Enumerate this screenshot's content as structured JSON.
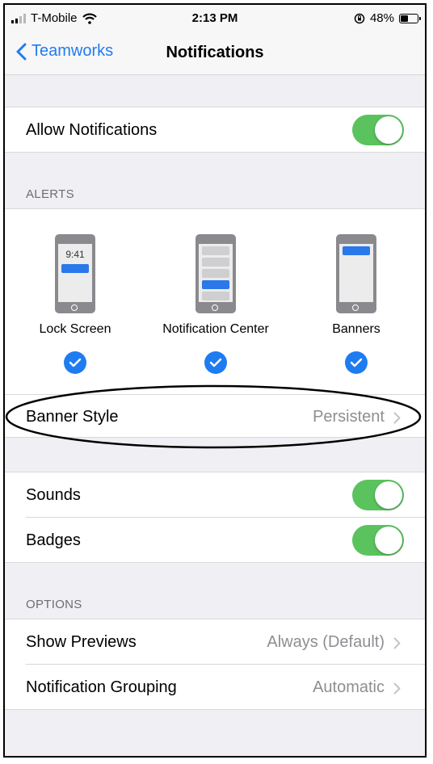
{
  "status_bar": {
    "carrier": "T-Mobile",
    "time": "2:13 PM",
    "battery": "48%",
    "battery_level": 0.48
  },
  "nav": {
    "back_label": "Teamworks",
    "title": "Notifications"
  },
  "allow_notifications": {
    "label": "Allow Notifications",
    "on": true
  },
  "alerts": {
    "header": "ALERTS",
    "lock_screen_time": "9:41",
    "options": [
      {
        "label": "Lock Screen",
        "checked": true
      },
      {
        "label": "Notification Center",
        "checked": true
      },
      {
        "label": "Banners",
        "checked": true
      }
    ],
    "banner_style": {
      "label": "Banner Style",
      "value": "Persistent"
    }
  },
  "sounds": {
    "label": "Sounds",
    "on": true
  },
  "badges": {
    "label": "Badges",
    "on": true
  },
  "options": {
    "header": "OPTIONS",
    "show_previews": {
      "label": "Show Previews",
      "value": "Always (Default)"
    },
    "grouping": {
      "label": "Notification Grouping",
      "value": "Automatic"
    }
  },
  "colors": {
    "accent": "#1f7cf0",
    "toggle_on": "#5ac35e",
    "background": "#efeff4"
  }
}
